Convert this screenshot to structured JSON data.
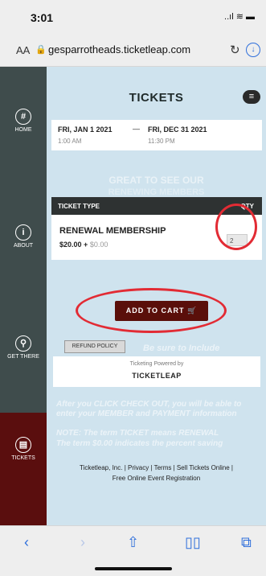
{
  "status_bar": {
    "time": "3:01",
    "signal": "..ıl ≋ ▬"
  },
  "browser": {
    "text_size": "AA",
    "url": "gesparrotheads.ticketleap.com"
  },
  "sidebar": {
    "items": [
      {
        "label": "HOME",
        "icon": "#"
      },
      {
        "label": "ABOUT",
        "icon": "i"
      },
      {
        "label": "GET THERE",
        "icon": "⚲"
      },
      {
        "label": "TICKETS",
        "icon": "▤"
      }
    ]
  },
  "page": {
    "title": "TICKETS"
  },
  "event": {
    "start_date": "FRI, JAN 1 2021",
    "start_time": "1:00 AM",
    "separator": "—",
    "end_date": "FRI, DEC 31 2021",
    "end_time": "11:30 PM"
  },
  "overlay": {
    "line1": "GREAT TO SEE OUR",
    "line2": "RENEWING MEMBERS",
    "note1": "Be sure to Include",
    "note2": "After you CLICK CHECK OUT, you will be able to enter your MEMBER and PAYMENT information",
    "note3": "NOTE: The term TICKET means RENEWAL",
    "note4": "The term $0.00 indicates the percent saving"
  },
  "tickets": {
    "col_type": "TICKET TYPE",
    "col_qty": "QTY",
    "rows": [
      {
        "name": "RENEWAL MEMBERSHIP",
        "price": "$20.00",
        "plus": "+",
        "fee": "$0.00",
        "qty": "2"
      }
    ]
  },
  "add_to_cart": "ADD TO CART",
  "refund_policy": "REFUND POLICY",
  "powered": {
    "label": "Ticketing Powered by",
    "brand": "TICKETLEAP"
  },
  "footer": {
    "line1": "Ticketleap, Inc. | Privacy | Terms | Sell Tickets Online |",
    "line2": "Free Online Event Registration"
  },
  "colors": {
    "sidebar": "#3f4c4c",
    "active_nav": "#5a0e0e",
    "content_bg": "#cfe3ee",
    "cart_button": "#5a0f0a",
    "annotation_ring": "#e22b34",
    "browser_blue": "#2f6fdb"
  },
  "icons": [
    "lock-icon",
    "reload-icon",
    "download-icon",
    "hamburger-icon",
    "cart-icon",
    "back-icon",
    "forward-icon",
    "share-icon",
    "bookmarks-icon",
    "tabs-icon"
  ]
}
